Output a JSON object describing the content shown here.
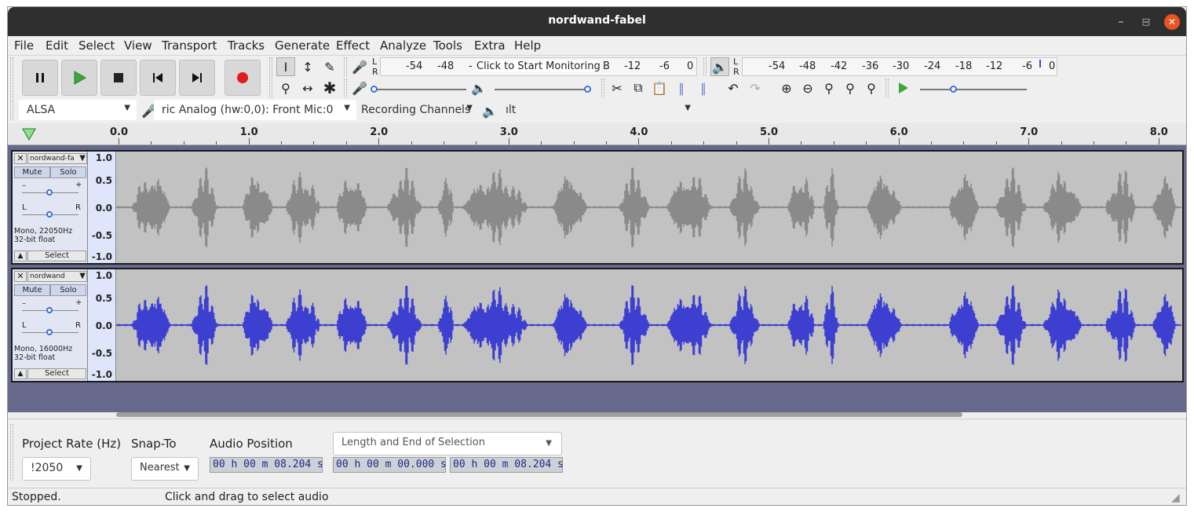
{
  "window": {
    "title": "nordwand-fabel"
  },
  "menu": [
    "File",
    "Edit",
    "Select",
    "View",
    "Transport",
    "Tracks",
    "Generate",
    "Effect",
    "Analyze",
    "Tools",
    "Extra",
    "Help"
  ],
  "rec_meter": {
    "lr": "L R",
    "ticks": [
      "-54",
      "-48",
      "-",
      "B",
      "-12",
      "-6",
      "0"
    ],
    "overlay": "Click to Start Monitoring"
  },
  "play_meter": {
    "lr": "L R",
    "ticks": [
      "-54",
      "-48",
      "-42",
      "-36",
      "-30",
      "-24",
      "-18",
      "-12",
      "-6",
      "0"
    ]
  },
  "device": {
    "host": "ALSA",
    "input": "ric Analog (hw:0,0): Front Mic:0",
    "channels": "Recording Channels",
    "output": "ılt"
  },
  "ruler": [
    "0.0",
    "1.0",
    "2.0",
    "3.0",
    "4.0",
    "5.0",
    "6.0",
    "7.0",
    "8.0"
  ],
  "tracks": [
    {
      "name": "nordwand-fa",
      "mute": "Mute",
      "solo": "Solo",
      "gain_l": "–",
      "gain_r": "+",
      "pan_l": "L",
      "pan_r": "R",
      "info1": "Mono, 22050Hz",
      "info2": "32-bit float",
      "select": "Select",
      "scale": [
        "1.0",
        "0.5",
        "0.0",
        "-0.5",
        "-1.0"
      ],
      "color": "#8a8a8a"
    },
    {
      "name": "nordwand",
      "mute": "Mute",
      "solo": "Solo",
      "gain_l": "–",
      "gain_r": "+",
      "pan_l": "L",
      "pan_r": "R",
      "info1": "Mono, 16000Hz",
      "info2": "32-bit float",
      "select": "Select",
      "scale": [
        "1.0",
        "0.5",
        "0.0",
        "-0.5",
        "-1.0"
      ],
      "color": "#3c3fd0"
    }
  ],
  "bottom": {
    "rate_label": "Project Rate (Hz)",
    "rate_value": "!2050",
    "snap_label": "Snap-To",
    "snap_value": "Nearest",
    "pos_label": "Audio Position",
    "sel_mode": "Length and End of Selection",
    "audio_position": "00 h 00 m 08.204 s",
    "sel_start": "00 h 00 m 00.000 s",
    "sel_end": "00 h 00 m 08.204 s"
  },
  "status": {
    "left": "Stopped.",
    "right": "Click and drag to select audio"
  }
}
